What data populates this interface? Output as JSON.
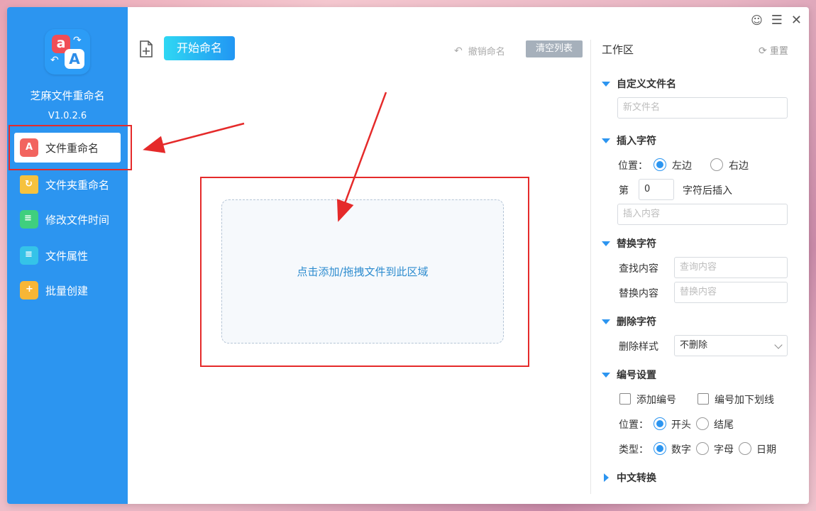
{
  "sidebar": {
    "app_name": "芝麻文件重命名",
    "version": "V1.0.2.6",
    "items": [
      {
        "label": "文件重命名",
        "icon": "file-rename-icon"
      },
      {
        "label": "文件夹重命名",
        "icon": "folder-rename-icon"
      },
      {
        "label": "修改文件时间",
        "icon": "edit-time-icon"
      },
      {
        "label": "文件属性",
        "icon": "file-properties-icon"
      },
      {
        "label": "批量创建",
        "icon": "batch-create-icon"
      }
    ]
  },
  "toolbar": {
    "start_label": "开始命名",
    "undo_label": "撤销命名",
    "clear_label": "清空列表"
  },
  "dropzone": {
    "text": "点击添加/拖拽文件到此区域"
  },
  "workspace": {
    "title": "工作区",
    "reset_label": "重置",
    "custom_name": {
      "title": "自定义文件名",
      "placeholder": "新文件名"
    },
    "insert": {
      "title": "插入字符",
      "position_label": "位置：",
      "left_label": "左边",
      "right_label": "右边",
      "nth_label": "第",
      "nth_value": "0",
      "after_label": "字符后插入",
      "content_placeholder": "插入内容"
    },
    "replace": {
      "title": "替换字符",
      "find_label": "查找内容",
      "find_placeholder": "查询内容",
      "replace_label": "替换内容",
      "replace_placeholder": "替换内容"
    },
    "delete": {
      "title": "删除字符",
      "style_label": "删除样式",
      "style_value": "不删除"
    },
    "numbering": {
      "title": "编号设置",
      "add_number_label": "添加编号",
      "underline_label": "编号加下划线",
      "position_label": "位置：",
      "start_label": "开头",
      "end_label": "结尾",
      "type_label": "类型：",
      "digit_label": "数字",
      "letter_label": "字母",
      "date_label": "日期"
    },
    "chinese": {
      "title": "中文转换"
    }
  },
  "colors": {
    "sidebar": "#2c95f0",
    "accent": "#2c95f0",
    "highlight": "#e52a2a"
  }
}
